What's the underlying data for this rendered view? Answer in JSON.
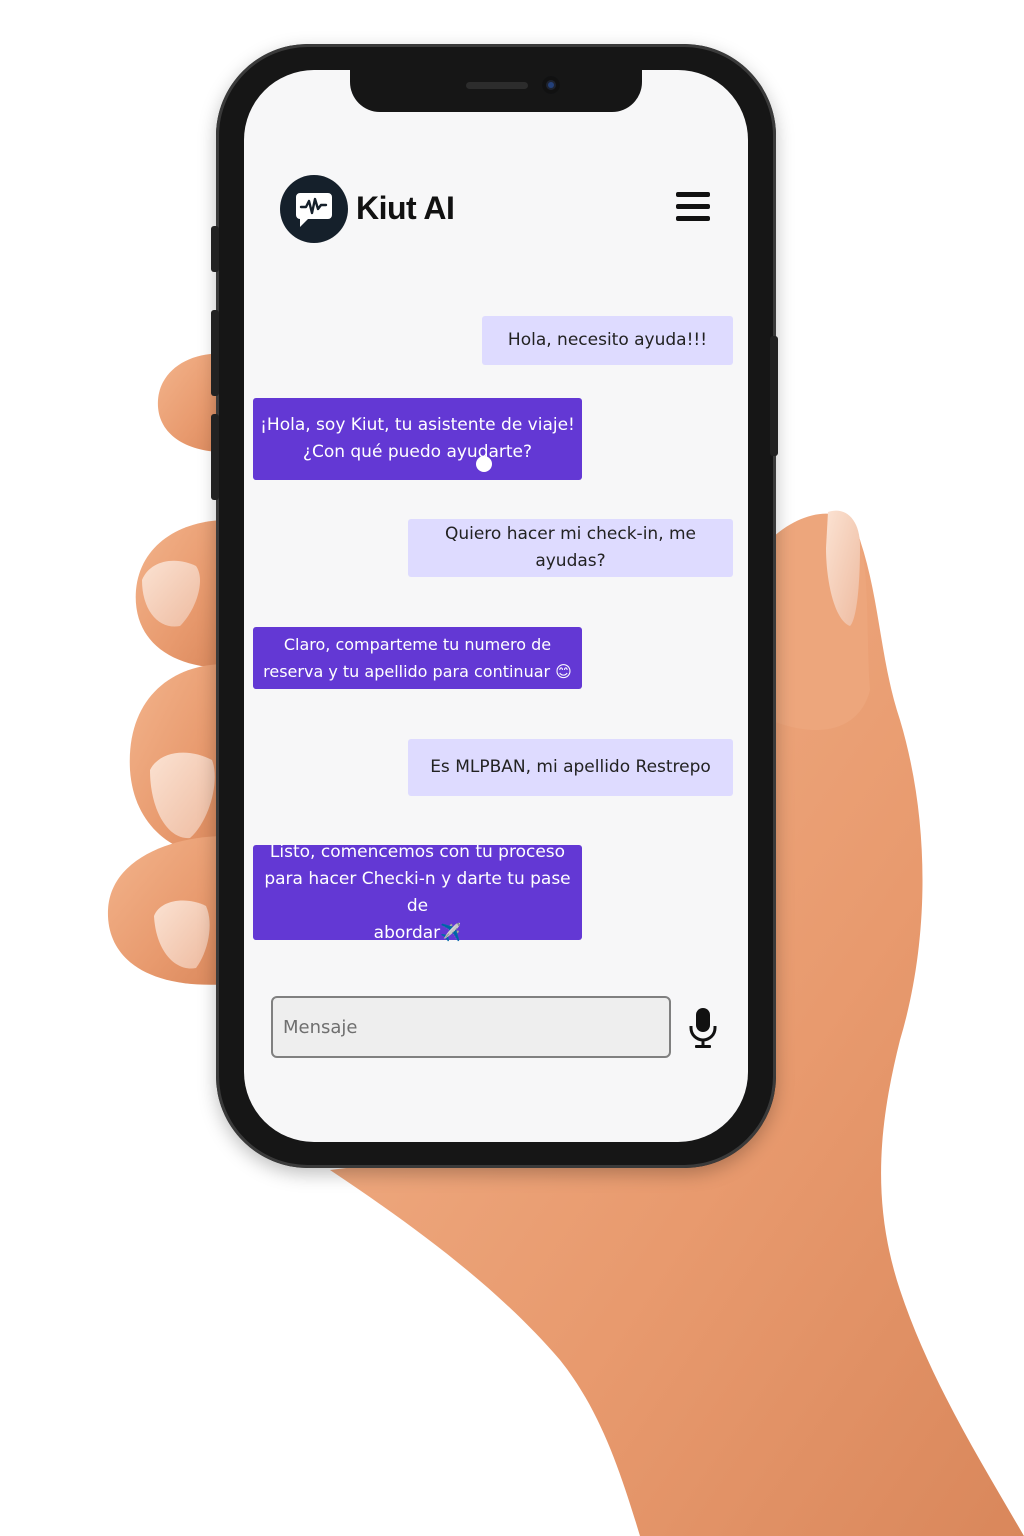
{
  "app": {
    "brand_name": "Kiut AI",
    "logo_icon": "chat-wave-icon",
    "menu_icon": "hamburger-menu-icon"
  },
  "chat": {
    "messages": [
      {
        "sender": "user",
        "text": "Hola, necesito ayuda!!!"
      },
      {
        "sender": "bot",
        "text": "¡Hola, soy Kiut, tu asistente de viaje!\n¿Con qué puedo ayudarte?"
      },
      {
        "sender": "user",
        "text": "Quiero hacer mi check-in, me ayudas?"
      },
      {
        "sender": "bot",
        "text": "Claro, comparteme tu numero de\nreserva y tu apellido para continuar 😊"
      },
      {
        "sender": "user",
        "text": "Es MLPBAN, mi apellido Restrepo"
      },
      {
        "sender": "bot",
        "text": "Listo, comencemos con tu proceso\npara hacer Checki-n y darte tu pase de\nabordar✈️"
      }
    ]
  },
  "composer": {
    "placeholder": "Mensaje",
    "value": "",
    "mic_icon": "microphone-icon"
  },
  "colors": {
    "user_bubble": "#dedbff",
    "bot_bubble": "#6338d4",
    "screen_bg": "#f7f7f8",
    "logo_bg": "#15202b"
  }
}
